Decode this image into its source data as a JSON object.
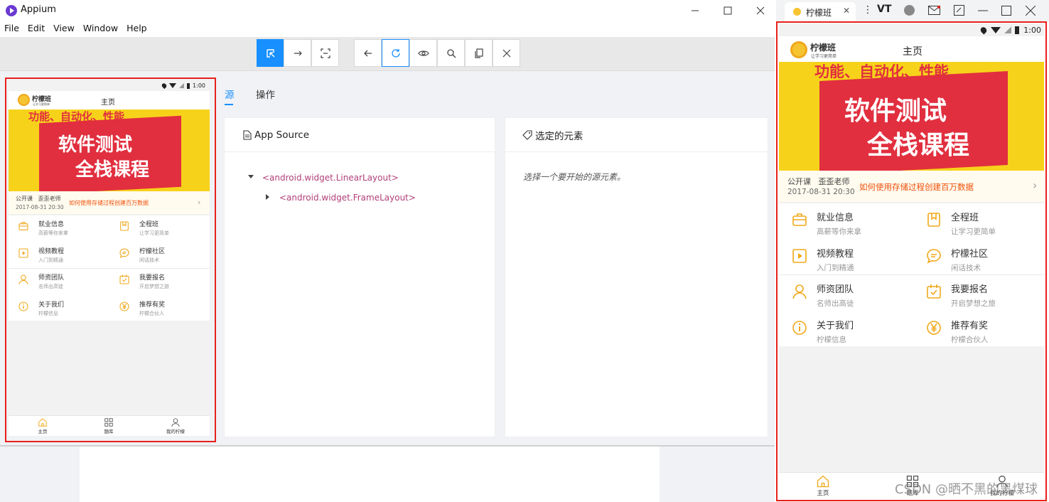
{
  "window": {
    "title": "Appium"
  },
  "menu": [
    "File",
    "Edit",
    "View",
    "Window",
    "Help"
  ],
  "toolbar": {
    "left_icons": [
      "select-element-icon",
      "swipe-icon",
      "tap-coordinates-icon"
    ],
    "right_icons": [
      "back-icon",
      "refresh-icon",
      "eye-icon",
      "search-icon",
      "copy-icon",
      "close-icon"
    ]
  },
  "tabs": {
    "source": "源",
    "actions": "操作"
  },
  "app_source": {
    "title": "App Source",
    "tree": [
      {
        "label": "<android.widget.LinearLayout>",
        "expanded": true
      },
      {
        "label": "<android.widget.FrameLayout>",
        "expanded": false
      }
    ]
  },
  "selected": {
    "title": "选定的元素",
    "hint": "选择一个要开始的源元素。"
  },
  "phone": {
    "time": "1:00",
    "logo_name": "柠檬班",
    "logo_slogan": "让学习更简单",
    "header_title": "主页",
    "banner": {
      "top": "功能、自动化、性能",
      "line1": "软件测试",
      "line2": "全栈课程"
    },
    "notice": {
      "tag": "公开课",
      "teacher": "歪歪老师",
      "date": "2017-08-31 20:30",
      "text": "如何使用存储过程创建百万数据"
    },
    "grid": [
      {
        "title": "就业信息",
        "sub": "高薪等你来拿",
        "icon": "briefcase-icon"
      },
      {
        "title": "全程班",
        "sub": "让学习更简单",
        "icon": "bookmark-icon"
      },
      {
        "title": "视频教程",
        "sub": "入门到精通",
        "icon": "play-icon"
      },
      {
        "title": "柠檬社区",
        "sub": "闲话技术",
        "icon": "chat-icon"
      },
      {
        "title": "师资团队",
        "sub": "名师出高徒",
        "icon": "person-icon"
      },
      {
        "title": "我要报名",
        "sub": "开启梦想之旅",
        "icon": "calendar-check-icon"
      },
      {
        "title": "关于我们",
        "sub": "柠檬信息",
        "icon": "info-icon"
      },
      {
        "title": "推荐有奖",
        "sub": "柠檬合伙人",
        "icon": "yen-icon"
      }
    ],
    "nav": [
      "主页",
      "题库",
      "我的柠檬"
    ]
  },
  "mini_window": {
    "tab_title": "柠檬班",
    "label": "VT"
  },
  "watermark": "CSDN @晒不黑的黑煤球",
  "colors": {
    "accent": "#1890ff",
    "highlight": "#e8201a",
    "brand_orange": "#f0a81a",
    "banner_red": "#e12f3f"
  }
}
